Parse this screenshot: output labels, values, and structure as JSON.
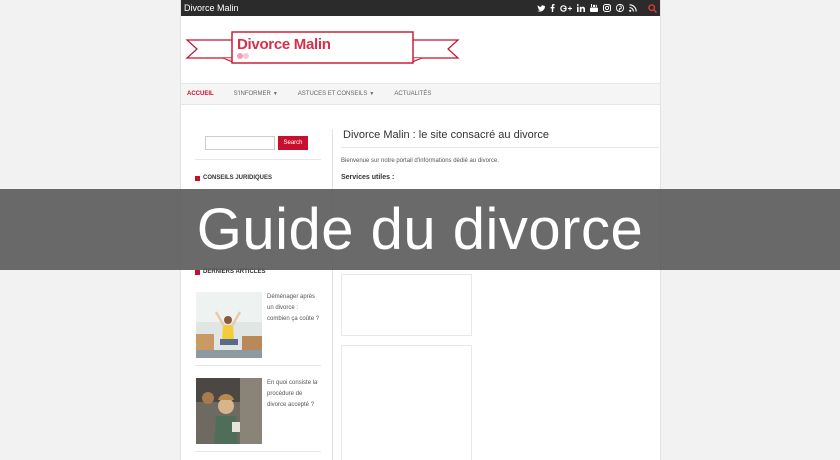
{
  "topbar": {
    "brand": "Divorce Malin",
    "icons": [
      "twitter-icon",
      "facebook-icon",
      "google-plus-icon",
      "linkedin-icon",
      "youtube-icon",
      "instagram-icon",
      "pinterest-icon",
      "rss-icon"
    ],
    "search_icon": "search-icon"
  },
  "logo": {
    "text": "Divorce Malin"
  },
  "nav": {
    "items": [
      {
        "label": "ACCUEIL"
      },
      {
        "label": "S'INFORMER"
      },
      {
        "label": "ASTUCES ET CONSEILS"
      },
      {
        "label": "ACTUALITÉS"
      }
    ]
  },
  "sidebar": {
    "search_button": "Search",
    "widgets": [
      {
        "title": "CONSEILS JURIDIQUES"
      },
      {
        "title": "DERNIERS ARTICLES"
      }
    ],
    "posts": [
      {
        "title": "Déménager après un divorce : combien ça coûte ?"
      },
      {
        "title": "En quoi consiste la procédure de divorce accepté ?"
      }
    ]
  },
  "main": {
    "heading": "Divorce Malin : le site consacré au divorce",
    "intro": "Bienvenue sur notre portail d'informations dédié au divorce.",
    "services_label": "Services utiles :"
  },
  "overlay": {
    "title": "Guide du divorce"
  },
  "colors": {
    "accent": "#c8102e",
    "topbar": "#2b2b2b",
    "overlay": "#555555"
  }
}
